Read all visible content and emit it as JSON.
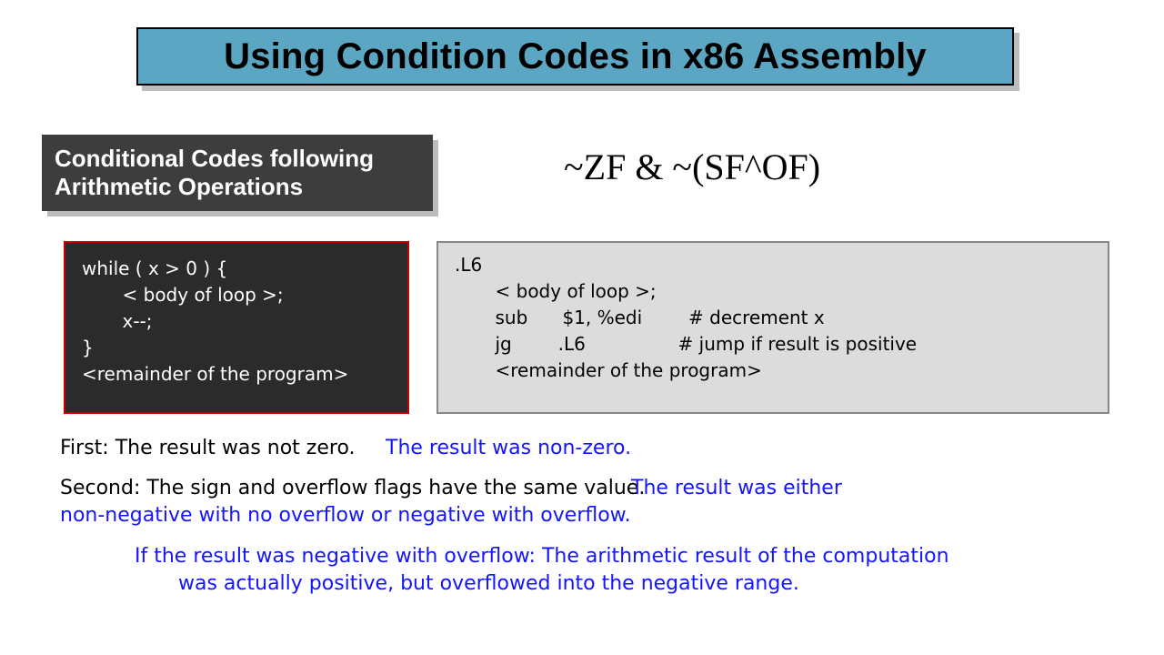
{
  "title": "Using Condition Codes in x86 Assembly",
  "subtitle": "Conditional Codes following Arithmetic Operations",
  "formula": "~ZF & ~(SF^OF)",
  "code_c": "while ( x > 0 ) {\n       < body of loop >;\n       x--;\n}\n<remainder of the program>",
  "code_asm": ".L6\n       < body of loop >;\n       sub      $1, %edi        # decrement x\n       jg        .L6                # jump if result is positive\n       <remainder of the program>",
  "lines": {
    "r1a": "First: The result was not zero.",
    "r1b": "The result was non-zero.",
    "r2a": "Second: The sign and overflow flags have the same value.",
    "r2b": "The result was either",
    "r3": "non-negative with no overflow or negative with overflow.",
    "r4": "If the result was negative with overflow:  The arithmetic result of the computation",
    "r5": "was actually positive, but overflowed into the negative range."
  }
}
